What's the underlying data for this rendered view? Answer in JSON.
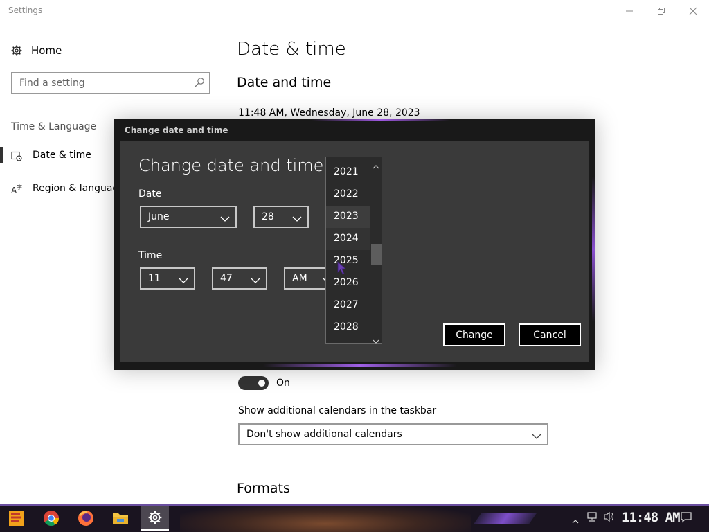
{
  "window": {
    "title": "Settings"
  },
  "sidebar": {
    "home_label": "Home",
    "search_placeholder": "Find a setting",
    "section_label": "Time & Language",
    "items": [
      {
        "label": "Date & time"
      },
      {
        "label": "Region & language"
      }
    ]
  },
  "main": {
    "title": "Date & time",
    "subtitle": "Date and time",
    "current_datetime": "11:48 AM, Wednesday, June 28, 2023",
    "toggle_state": "On",
    "calendars_label": "Show additional calendars in the taskbar",
    "calendars_value": "Don't show additional calendars",
    "formats_heading": "Formats"
  },
  "dialog": {
    "caption": "Change date and time",
    "heading": "Change date and time",
    "date_label": "Date",
    "time_label": "Time",
    "month": "June",
    "day": "28",
    "hour": "11",
    "minute": "47",
    "ampm": "AM",
    "change_label": "Change",
    "cancel_label": "Cancel",
    "years": [
      "2021",
      "2022",
      "2023",
      "2024",
      "2025",
      "2026",
      "2027",
      "2028"
    ],
    "selected_year": "2023",
    "hovered_year": "2024"
  },
  "taskbar": {
    "clock": "11:48 AM",
    "apps": [
      "start",
      "chrome",
      "firefox",
      "file-explorer",
      "settings"
    ]
  },
  "colors": {
    "dialog_bg": "#3a3a3a",
    "dialog_frame": "#191919",
    "accent_purple": "#9d58e0"
  }
}
